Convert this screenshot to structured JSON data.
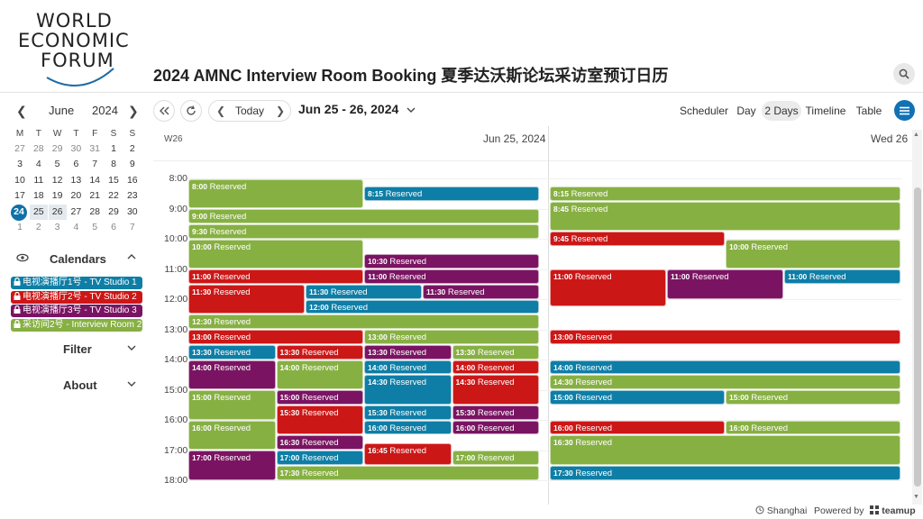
{
  "header": {
    "logo_lines": [
      "WORLD",
      "ECONOMIC",
      "FORUM"
    ],
    "title": "2024 AMNC Interview Room Booking 夏季达沃斯论坛采访室预订日历",
    "search_icon": "search-icon"
  },
  "mini_calendar": {
    "month": "June",
    "year": "2024",
    "weekdays": [
      "M",
      "T",
      "W",
      "T",
      "F",
      "S",
      "S"
    ],
    "weeks": [
      [
        "27",
        "28",
        "29",
        "30",
        "31",
        "1",
        "2"
      ],
      [
        "3",
        "4",
        "5",
        "6",
        "7",
        "8",
        "9"
      ],
      [
        "10",
        "11",
        "12",
        "13",
        "14",
        "15",
        "16"
      ],
      [
        "17",
        "18",
        "19",
        "20",
        "21",
        "22",
        "23"
      ],
      [
        "24",
        "25",
        "26",
        "27",
        "28",
        "29",
        "30"
      ],
      [
        "1",
        "2",
        "3",
        "4",
        "5",
        "6",
        "7"
      ]
    ],
    "today": "24",
    "selected": [
      "25",
      "26"
    ]
  },
  "calendars": {
    "title": "Calendars",
    "items": [
      {
        "label": "电视演播厅1号 - TV Studio 1",
        "color": "#0e7ea6"
      },
      {
        "label": "电视演播厅2号 - TV Studio 2",
        "color": "#cc1717"
      },
      {
        "label": "电视演播厅3号 - TV Studio 3",
        "color": "#7a1462"
      },
      {
        "label": "采访间2号 - Interview Room 2",
        "color": "#87b043"
      }
    ]
  },
  "sidebar_links": {
    "filter": "Filter",
    "about": "About"
  },
  "toolbar": {
    "today": "Today",
    "date_range": "Jun 25 - 26, 2024",
    "views": [
      "Scheduler",
      "Day",
      "2 Days",
      "Timeline",
      "Table"
    ],
    "active_view": "2 Days"
  },
  "grid": {
    "week": "W26",
    "days": [
      "Jun 25, 2024",
      "Wed 26"
    ],
    "hours": [
      "8:00",
      "9:00",
      "10:00",
      "11:00",
      "12:00",
      "13:00",
      "14:00",
      "15:00",
      "16:00",
      "17:00",
      "18:00"
    ],
    "first_hour": 8
  },
  "event_label": "Reserved",
  "events": [
    {
      "day": 0,
      "start": "8:00",
      "end": "9:00",
      "cal": 3,
      "col": 0,
      "cols": 2
    },
    {
      "day": 0,
      "start": "8:15",
      "end": "8:45",
      "cal": 0,
      "col": 1,
      "cols": 2
    },
    {
      "day": 0,
      "start": "9:00",
      "end": "9:30",
      "cal": 3,
      "col": 0,
      "cols": 1
    },
    {
      "day": 0,
      "start": "9:30",
      "end": "10:00",
      "cal": 3,
      "col": 0,
      "cols": 1
    },
    {
      "day": 0,
      "start": "10:00",
      "end": "11:00",
      "cal": 3,
      "col": 0,
      "cols": 2
    },
    {
      "day": 0,
      "start": "10:30",
      "end": "11:00",
      "cal": 2,
      "col": 1,
      "cols": 2
    },
    {
      "day": 0,
      "start": "11:00",
      "end": "11:30",
      "cal": 1,
      "col": 0,
      "cols": 2
    },
    {
      "day": 0,
      "start": "11:00",
      "end": "11:30",
      "cal": 2,
      "col": 1,
      "cols": 2
    },
    {
      "day": 0,
      "start": "11:30",
      "end": "12:30",
      "cal": 1,
      "col": 0,
      "cols": 3
    },
    {
      "day": 0,
      "start": "11:30",
      "end": "12:00",
      "cal": 0,
      "col": 1,
      "cols": 3
    },
    {
      "day": 0,
      "start": "11:30",
      "end": "12:00",
      "cal": 2,
      "col": 2,
      "cols": 3
    },
    {
      "day": 0,
      "start": "12:00",
      "end": "12:30",
      "cal": 0,
      "col": 1,
      "cols": 3,
      "span": 2
    },
    {
      "day": 0,
      "start": "12:30",
      "end": "13:00",
      "cal": 3,
      "col": 0,
      "cols": 1
    },
    {
      "day": 0,
      "start": "13:00",
      "end": "13:30",
      "cal": 1,
      "col": 0,
      "cols": 2
    },
    {
      "day": 0,
      "start": "13:00",
      "end": "13:30",
      "cal": 3,
      "col": 1,
      "cols": 2
    },
    {
      "day": 0,
      "start": "13:30",
      "end": "14:00",
      "cal": 0,
      "col": 0,
      "cols": 4
    },
    {
      "day": 0,
      "start": "13:30",
      "end": "14:00",
      "cal": 1,
      "col": 1,
      "cols": 4
    },
    {
      "day": 0,
      "start": "13:30",
      "end": "14:00",
      "cal": 2,
      "col": 2,
      "cols": 4
    },
    {
      "day": 0,
      "start": "13:30",
      "end": "14:00",
      "cal": 3,
      "col": 3,
      "cols": 4
    },
    {
      "day": 0,
      "start": "14:00",
      "end": "15:00",
      "cal": 2,
      "col": 0,
      "cols": 4
    },
    {
      "day": 0,
      "start": "14:00",
      "end": "15:00",
      "cal": 3,
      "col": 1,
      "cols": 4
    },
    {
      "day": 0,
      "start": "14:00",
      "end": "14:30",
      "cal": 0,
      "col": 2,
      "cols": 4
    },
    {
      "day": 0,
      "start": "14:00",
      "end": "14:30",
      "cal": 1,
      "col": 3,
      "cols": 4
    },
    {
      "day": 0,
      "start": "14:30",
      "end": "15:30",
      "cal": 0,
      "col": 2,
      "cols": 4
    },
    {
      "day": 0,
      "start": "14:30",
      "end": "15:30",
      "cal": 1,
      "col": 3,
      "cols": 4
    },
    {
      "day": 0,
      "start": "15:00",
      "end": "16:00",
      "cal": 3,
      "col": 0,
      "cols": 4
    },
    {
      "day": 0,
      "start": "15:00",
      "end": "15:30",
      "cal": 2,
      "col": 1,
      "cols": 4
    },
    {
      "day": 0,
      "start": "15:30",
      "end": "16:30",
      "cal": 1,
      "col": 1,
      "cols": 4
    },
    {
      "day": 0,
      "start": "15:30",
      "end": "16:00",
      "cal": 0,
      "col": 2,
      "cols": 4
    },
    {
      "day": 0,
      "start": "15:30",
      "end": "16:00",
      "cal": 2,
      "col": 3,
      "cols": 4
    },
    {
      "day": 0,
      "start": "16:00",
      "end": "17:00",
      "cal": 3,
      "col": 0,
      "cols": 4
    },
    {
      "day": 0,
      "start": "16:00",
      "end": "16:30",
      "cal": 0,
      "col": 2,
      "cols": 4
    },
    {
      "day": 0,
      "start": "16:00",
      "end": "16:30",
      "cal": 2,
      "col": 3,
      "cols": 4
    },
    {
      "day": 0,
      "start": "16:30",
      "end": "17:00",
      "cal": 2,
      "col": 1,
      "cols": 4
    },
    {
      "day": 0,
      "start": "16:45",
      "end": "17:30",
      "cal": 1,
      "col": 2,
      "cols": 4
    },
    {
      "day": 0,
      "start": "17:00",
      "end": "18:00",
      "cal": 2,
      "col": 0,
      "cols": 4
    },
    {
      "day": 0,
      "start": "17:00",
      "end": "17:30",
      "cal": 0,
      "col": 1,
      "cols": 4
    },
    {
      "day": 0,
      "start": "17:00",
      "end": "17:30",
      "cal": 3,
      "col": 3,
      "cols": 4
    },
    {
      "day": 0,
      "start": "17:30",
      "end": "18:00",
      "cal": 3,
      "col": 1,
      "cols": 4,
      "span": 3
    },
    {
      "day": 1,
      "start": "8:15",
      "end": "8:45",
      "cal": 3,
      "col": 0,
      "cols": 1
    },
    {
      "day": 1,
      "start": "8:45",
      "end": "9:45",
      "cal": 3,
      "col": 0,
      "cols": 1
    },
    {
      "day": 1,
      "start": "9:45",
      "end": "10:15",
      "cal": 1,
      "col": 0,
      "cols": 2
    },
    {
      "day": 1,
      "start": "10:00",
      "end": "11:00",
      "cal": 3,
      "col": 1,
      "cols": 2
    },
    {
      "day": 1,
      "start": "11:00",
      "end": "12:15",
      "cal": 1,
      "col": 0,
      "cols": 3
    },
    {
      "day": 1,
      "start": "11:00",
      "end": "12:00",
      "cal": 2,
      "col": 1,
      "cols": 3
    },
    {
      "day": 1,
      "start": "11:00",
      "end": "11:30",
      "cal": 0,
      "col": 2,
      "cols": 3
    },
    {
      "day": 1,
      "start": "13:00",
      "end": "13:30",
      "cal": 1,
      "col": 0,
      "cols": 1
    },
    {
      "day": 1,
      "start": "14:00",
      "end": "14:30",
      "cal": 0,
      "col": 0,
      "cols": 1
    },
    {
      "day": 1,
      "start": "14:30",
      "end": "15:00",
      "cal": 3,
      "col": 0,
      "cols": 1
    },
    {
      "day": 1,
      "start": "15:00",
      "end": "15:30",
      "cal": 0,
      "col": 0,
      "cols": 2
    },
    {
      "day": 1,
      "start": "15:00",
      "end": "15:30",
      "cal": 3,
      "col": 1,
      "cols": 2
    },
    {
      "day": 1,
      "start": "16:00",
      "end": "16:30",
      "cal": 1,
      "col": 0,
      "cols": 2
    },
    {
      "day": 1,
      "start": "16:00",
      "end": "16:30",
      "cal": 3,
      "col": 1,
      "cols": 2
    },
    {
      "day": 1,
      "start": "16:30",
      "end": "17:30",
      "cal": 3,
      "col": 0,
      "cols": 1
    },
    {
      "day": 1,
      "start": "17:30",
      "end": "18:00",
      "cal": 0,
      "col": 0,
      "cols": 1
    }
  ],
  "footer": {
    "timezone": "Shanghai",
    "powered_by": "Powered by",
    "brand": "teamup"
  }
}
